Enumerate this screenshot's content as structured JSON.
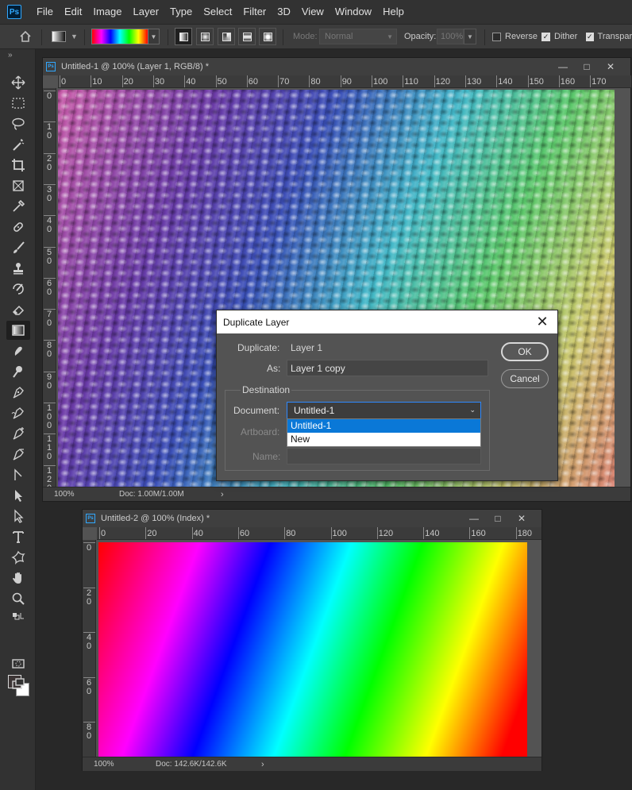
{
  "app": {
    "logo": "Ps"
  },
  "menu": [
    "File",
    "Edit",
    "Image",
    "Layer",
    "Type",
    "Select",
    "Filter",
    "3D",
    "View",
    "Window",
    "Help"
  ],
  "options_bar": {
    "mode_label": "Mode:",
    "mode_value": "Normal",
    "opacity_label": "Opacity:",
    "opacity_value": "100%",
    "reverse_label": "Reverse",
    "reverse_checked": false,
    "dither_label": "Dither",
    "dither_checked": true,
    "transparency_label": "Transparency",
    "transparency_checked": true,
    "gradient_colors": [
      "#ff0000",
      "#ff00ff",
      "#0000ff",
      "#00ffff",
      "#00ff00",
      "#ffff00",
      "#ff0000"
    ]
  },
  "doc1": {
    "title": "Untitled-1 @ 100% (Layer 1, RGB/8) *",
    "ruler_h": [
      "0",
      "10",
      "20",
      "30",
      "40",
      "50",
      "60",
      "70",
      "80",
      "90",
      "100",
      "110",
      "120",
      "130",
      "140",
      "150",
      "160",
      "170"
    ],
    "ruler_v": [
      "0",
      "10",
      "20",
      "30",
      "40",
      "50",
      "60",
      "70",
      "80",
      "90",
      "100",
      "110",
      "120"
    ],
    "zoom": "100%",
    "doc_size": "Doc: 1.00M/1.00M"
  },
  "doc2": {
    "title": "Untitled-2 @ 100% (Index) *",
    "ruler_h": [
      "0",
      "20",
      "40",
      "60",
      "80",
      "100",
      "120",
      "140",
      "160",
      "180"
    ],
    "ruler_v": [
      "0",
      "20",
      "40",
      "60",
      "80"
    ],
    "zoom": "100%",
    "doc_size": "Doc: 142.6K/142.6K"
  },
  "dialog": {
    "title": "Duplicate Layer",
    "duplicate_label": "Duplicate:",
    "duplicate_value": "Layer 1",
    "as_label": "As:",
    "as_value": "Layer 1 copy",
    "destination_label": "Destination",
    "document_label": "Document:",
    "document_value": "Untitled-1",
    "document_options": [
      "Untitled-1",
      "New"
    ],
    "artboard_label": "Artboard:",
    "name_label": "Name:",
    "ok_label": "OK",
    "cancel_label": "Cancel"
  }
}
